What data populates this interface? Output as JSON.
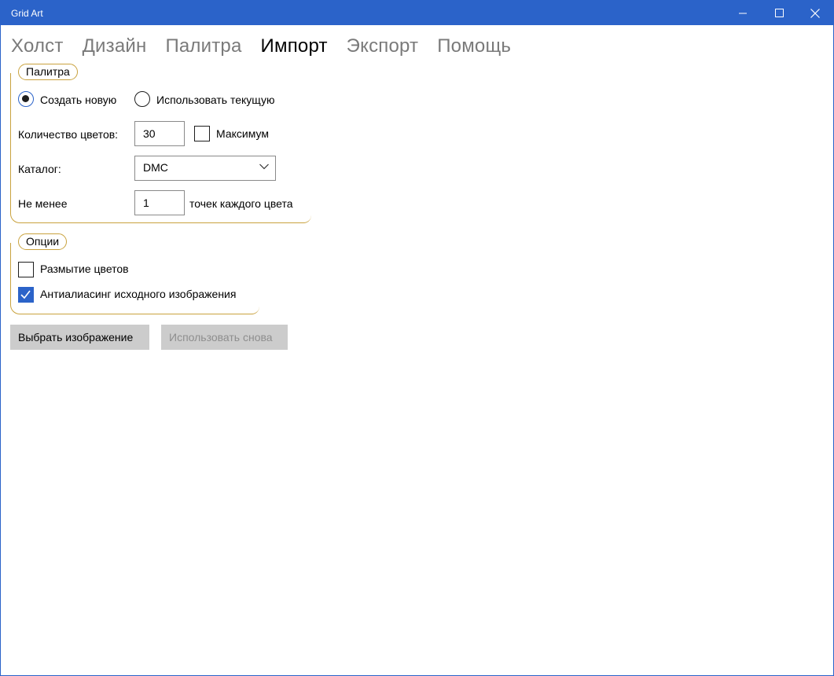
{
  "window": {
    "title": "Grid Art"
  },
  "tabs": [
    {
      "label": "Холст",
      "active": false
    },
    {
      "label": "Дизайн",
      "active": false
    },
    {
      "label": "Палитра",
      "active": false
    },
    {
      "label": "Импорт",
      "active": true
    },
    {
      "label": "Экспорт",
      "active": false
    },
    {
      "label": "Помощь",
      "active": false
    }
  ],
  "palette_group": {
    "legend": "Палитра",
    "radio_new": {
      "label": "Создать новую",
      "checked": true
    },
    "radio_current": {
      "label": "Использовать текущую",
      "checked": false
    },
    "color_count": {
      "label": "Количество цветов:",
      "value": "30"
    },
    "maximum": {
      "label": "Максимум",
      "checked": false
    },
    "catalog": {
      "label": "Каталог:",
      "value": "DMC"
    },
    "min_points": {
      "label": "Не менее",
      "value": "1",
      "suffix": "точек каждого цвета"
    }
  },
  "options_group": {
    "legend": "Опции",
    "blur": {
      "label": "Размытие цветов",
      "checked": false
    },
    "antialias": {
      "label": "Антиалиасинг исходного изображения",
      "checked": true
    }
  },
  "buttons": {
    "choose_image": "Выбрать изображение",
    "reuse": "Использовать снова"
  },
  "colors": {
    "accent": "#2b63c9",
    "group_border": "#c9a23e",
    "button_bg": "#cccccc"
  },
  "icons": [
    "minimize-icon",
    "maximize-icon",
    "close-icon",
    "chevron-down-icon",
    "checkmark-icon"
  ]
}
